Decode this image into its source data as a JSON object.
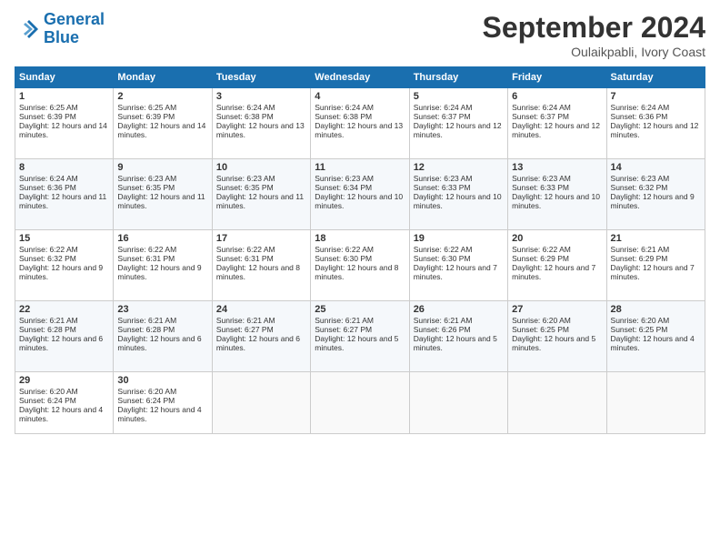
{
  "header": {
    "logo_line1": "General",
    "logo_line2": "Blue",
    "month": "September 2024",
    "location": "Oulaikpabli, Ivory Coast"
  },
  "days_of_week": [
    "Sunday",
    "Monday",
    "Tuesday",
    "Wednesday",
    "Thursday",
    "Friday",
    "Saturday"
  ],
  "weeks": [
    [
      {
        "day": "1",
        "sunrise": "Sunrise: 6:25 AM",
        "sunset": "Sunset: 6:39 PM",
        "daylight": "Daylight: 12 hours and 14 minutes."
      },
      {
        "day": "2",
        "sunrise": "Sunrise: 6:25 AM",
        "sunset": "Sunset: 6:39 PM",
        "daylight": "Daylight: 12 hours and 14 minutes."
      },
      {
        "day": "3",
        "sunrise": "Sunrise: 6:24 AM",
        "sunset": "Sunset: 6:38 PM",
        "daylight": "Daylight: 12 hours and 13 minutes."
      },
      {
        "day": "4",
        "sunrise": "Sunrise: 6:24 AM",
        "sunset": "Sunset: 6:38 PM",
        "daylight": "Daylight: 12 hours and 13 minutes."
      },
      {
        "day": "5",
        "sunrise": "Sunrise: 6:24 AM",
        "sunset": "Sunset: 6:37 PM",
        "daylight": "Daylight: 12 hours and 12 minutes."
      },
      {
        "day": "6",
        "sunrise": "Sunrise: 6:24 AM",
        "sunset": "Sunset: 6:37 PM",
        "daylight": "Daylight: 12 hours and 12 minutes."
      },
      {
        "day": "7",
        "sunrise": "Sunrise: 6:24 AM",
        "sunset": "Sunset: 6:36 PM",
        "daylight": "Daylight: 12 hours and 12 minutes."
      }
    ],
    [
      {
        "day": "8",
        "sunrise": "Sunrise: 6:24 AM",
        "sunset": "Sunset: 6:36 PM",
        "daylight": "Daylight: 12 hours and 11 minutes."
      },
      {
        "day": "9",
        "sunrise": "Sunrise: 6:23 AM",
        "sunset": "Sunset: 6:35 PM",
        "daylight": "Daylight: 12 hours and 11 minutes."
      },
      {
        "day": "10",
        "sunrise": "Sunrise: 6:23 AM",
        "sunset": "Sunset: 6:35 PM",
        "daylight": "Daylight: 12 hours and 11 minutes."
      },
      {
        "day": "11",
        "sunrise": "Sunrise: 6:23 AM",
        "sunset": "Sunset: 6:34 PM",
        "daylight": "Daylight: 12 hours and 10 minutes."
      },
      {
        "day": "12",
        "sunrise": "Sunrise: 6:23 AM",
        "sunset": "Sunset: 6:33 PM",
        "daylight": "Daylight: 12 hours and 10 minutes."
      },
      {
        "day": "13",
        "sunrise": "Sunrise: 6:23 AM",
        "sunset": "Sunset: 6:33 PM",
        "daylight": "Daylight: 12 hours and 10 minutes."
      },
      {
        "day": "14",
        "sunrise": "Sunrise: 6:23 AM",
        "sunset": "Sunset: 6:32 PM",
        "daylight": "Daylight: 12 hours and 9 minutes."
      }
    ],
    [
      {
        "day": "15",
        "sunrise": "Sunrise: 6:22 AM",
        "sunset": "Sunset: 6:32 PM",
        "daylight": "Daylight: 12 hours and 9 minutes."
      },
      {
        "day": "16",
        "sunrise": "Sunrise: 6:22 AM",
        "sunset": "Sunset: 6:31 PM",
        "daylight": "Daylight: 12 hours and 9 minutes."
      },
      {
        "day": "17",
        "sunrise": "Sunrise: 6:22 AM",
        "sunset": "Sunset: 6:31 PM",
        "daylight": "Daylight: 12 hours and 8 minutes."
      },
      {
        "day": "18",
        "sunrise": "Sunrise: 6:22 AM",
        "sunset": "Sunset: 6:30 PM",
        "daylight": "Daylight: 12 hours and 8 minutes."
      },
      {
        "day": "19",
        "sunrise": "Sunrise: 6:22 AM",
        "sunset": "Sunset: 6:30 PM",
        "daylight": "Daylight: 12 hours and 7 minutes."
      },
      {
        "day": "20",
        "sunrise": "Sunrise: 6:22 AM",
        "sunset": "Sunset: 6:29 PM",
        "daylight": "Daylight: 12 hours and 7 minutes."
      },
      {
        "day": "21",
        "sunrise": "Sunrise: 6:21 AM",
        "sunset": "Sunset: 6:29 PM",
        "daylight": "Daylight: 12 hours and 7 minutes."
      }
    ],
    [
      {
        "day": "22",
        "sunrise": "Sunrise: 6:21 AM",
        "sunset": "Sunset: 6:28 PM",
        "daylight": "Daylight: 12 hours and 6 minutes."
      },
      {
        "day": "23",
        "sunrise": "Sunrise: 6:21 AM",
        "sunset": "Sunset: 6:28 PM",
        "daylight": "Daylight: 12 hours and 6 minutes."
      },
      {
        "day": "24",
        "sunrise": "Sunrise: 6:21 AM",
        "sunset": "Sunset: 6:27 PM",
        "daylight": "Daylight: 12 hours and 6 minutes."
      },
      {
        "day": "25",
        "sunrise": "Sunrise: 6:21 AM",
        "sunset": "Sunset: 6:27 PM",
        "daylight": "Daylight: 12 hours and 5 minutes."
      },
      {
        "day": "26",
        "sunrise": "Sunrise: 6:21 AM",
        "sunset": "Sunset: 6:26 PM",
        "daylight": "Daylight: 12 hours and 5 minutes."
      },
      {
        "day": "27",
        "sunrise": "Sunrise: 6:20 AM",
        "sunset": "Sunset: 6:25 PM",
        "daylight": "Daylight: 12 hours and 5 minutes."
      },
      {
        "day": "28",
        "sunrise": "Sunrise: 6:20 AM",
        "sunset": "Sunset: 6:25 PM",
        "daylight": "Daylight: 12 hours and 4 minutes."
      }
    ],
    [
      {
        "day": "29",
        "sunrise": "Sunrise: 6:20 AM",
        "sunset": "Sunset: 6:24 PM",
        "daylight": "Daylight: 12 hours and 4 minutes."
      },
      {
        "day": "30",
        "sunrise": "Sunrise: 6:20 AM",
        "sunset": "Sunset: 6:24 PM",
        "daylight": "Daylight: 12 hours and 4 minutes."
      },
      {
        "day": "",
        "sunrise": "",
        "sunset": "",
        "daylight": ""
      },
      {
        "day": "",
        "sunrise": "",
        "sunset": "",
        "daylight": ""
      },
      {
        "day": "",
        "sunrise": "",
        "sunset": "",
        "daylight": ""
      },
      {
        "day": "",
        "sunrise": "",
        "sunset": "",
        "daylight": ""
      },
      {
        "day": "",
        "sunrise": "",
        "sunset": "",
        "daylight": ""
      }
    ]
  ]
}
